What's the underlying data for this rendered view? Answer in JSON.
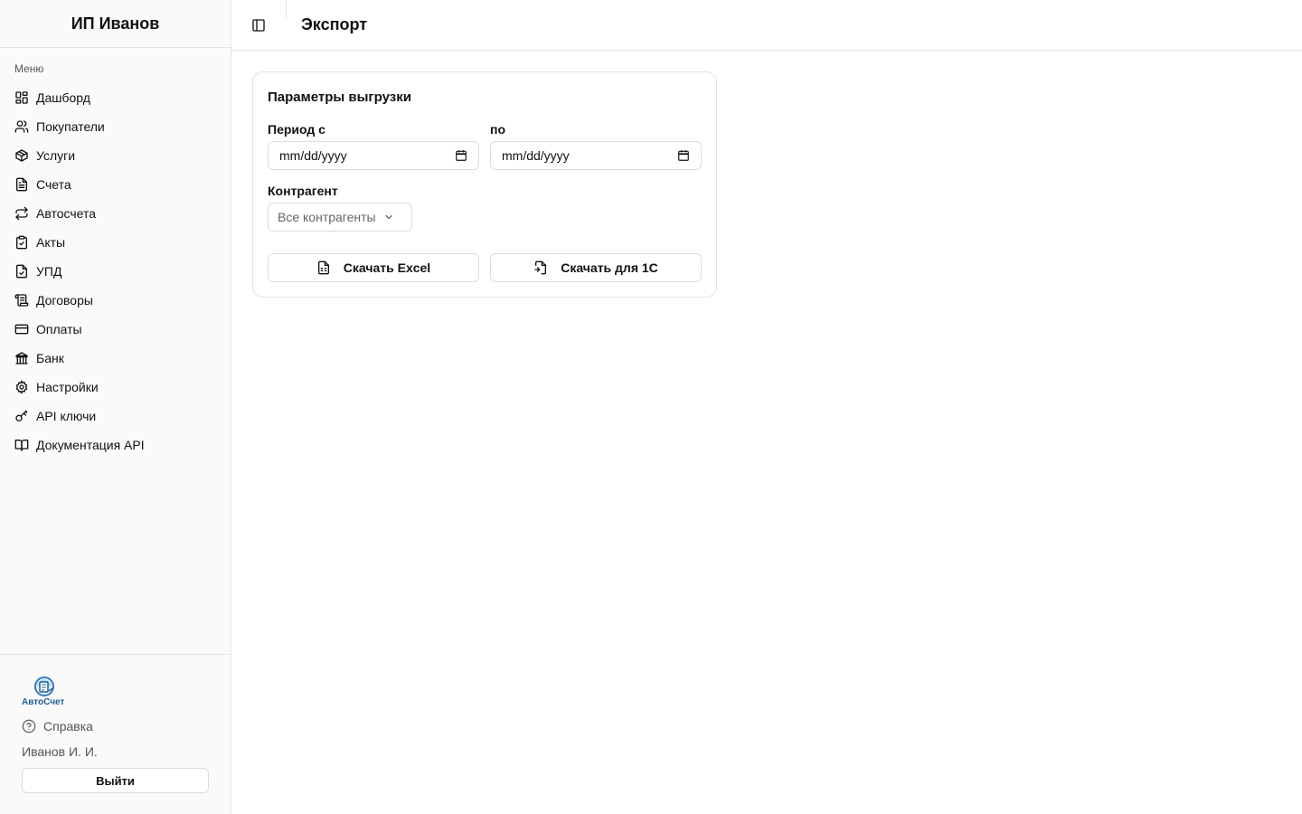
{
  "sidebar": {
    "brand": "ИП Иванов",
    "menu_label": "Меню",
    "items": [
      {
        "label": "Дашборд",
        "icon": "dashboard-icon"
      },
      {
        "label": "Покупатели",
        "icon": "users-icon"
      },
      {
        "label": "Услуги",
        "icon": "package-icon"
      },
      {
        "label": "Счета",
        "icon": "file-text-icon"
      },
      {
        "label": "Автосчета",
        "icon": "repeat-icon"
      },
      {
        "label": "Акты",
        "icon": "clipboard-check-icon"
      },
      {
        "label": "УПД",
        "icon": "file-check-icon"
      },
      {
        "label": "Договоры",
        "icon": "scroll-icon"
      },
      {
        "label": "Оплаты",
        "icon": "credit-card-icon"
      },
      {
        "label": "Банк",
        "icon": "bank-icon"
      },
      {
        "label": "Настройки",
        "icon": "gear-icon"
      },
      {
        "label": "API ключи",
        "icon": "key-icon"
      },
      {
        "label": "Документация API",
        "icon": "book-open-icon"
      }
    ],
    "footer": {
      "logo_text": "АвтоСчет",
      "help": "Справка",
      "user": "Иванов И. И.",
      "logout": "Выйти"
    }
  },
  "header": {
    "title": "Экспорт"
  },
  "export_card": {
    "title": "Параметры выгрузки",
    "period_from_label": "Период с",
    "period_from_value": "mm/dd/yyyy",
    "period_to_label": "по",
    "period_to_value": "mm/dd/yyyy",
    "counterparty_label": "Контрагент",
    "counterparty_value": "Все контрагенты",
    "excel_button": "Скачать Excel",
    "onec_button": "Скачать для 1С"
  }
}
